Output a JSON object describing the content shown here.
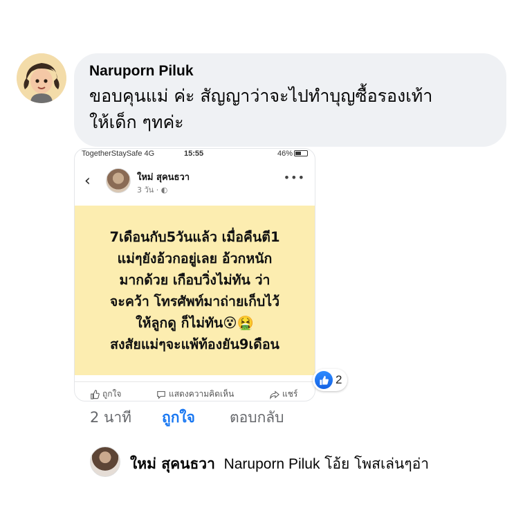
{
  "comment": {
    "author": "Naruporn Piluk",
    "text_line1": "ขอบคุนแม่ ค่ะ สัญญาว่าจะไปทำบุญซื้อรองเท้า",
    "text_line2": "ให้เด็ก ๆทค่ะ"
  },
  "shared_screenshot": {
    "status_bar": {
      "carrier": "TogetherStaySafe  4G",
      "time": "15:55",
      "battery": "46%"
    },
    "post": {
      "poster_name": "ใหม่ สุคนธวา",
      "meta": "3 วัน · ",
      "body_text": "7เดือนกับ5วันแล้ว เมื่อคืนตี1\nแม่ๆยังอ้วกอยู่เลย อ้วกหนัก\nมากด้วย เกือบวิ่งไม่ทัน ว่า\nจะคว้า โทรศัพท์มาถ่ายเก็บไว้\nให้ลูกดู ก็ไม่ทัน😵🤮\nสงสัยแม่ๆจะแพ้ท้องยัน9เดือน",
      "like_label": "ถูกใจ",
      "comment_label": "แสดงความคิดเห็น",
      "share_label": "แชร์"
    }
  },
  "reactions": {
    "count": "2",
    "icon": "like-thumb-icon",
    "color": "#1877f2"
  },
  "comment_actions": {
    "time": "2 นาที",
    "like": "ถูกใจ",
    "reply": "ตอบกลับ"
  },
  "reply": {
    "name": "ใหม่ สุคนธวา",
    "tag": "Naruporn Piluk",
    "text": "โอ้ย โพสเล่นๆอ่า"
  },
  "colors": {
    "bubble": "#eff1f4",
    "post_background": "#fcedb0",
    "link_blue": "#1877f2",
    "muted": "#65676b"
  }
}
